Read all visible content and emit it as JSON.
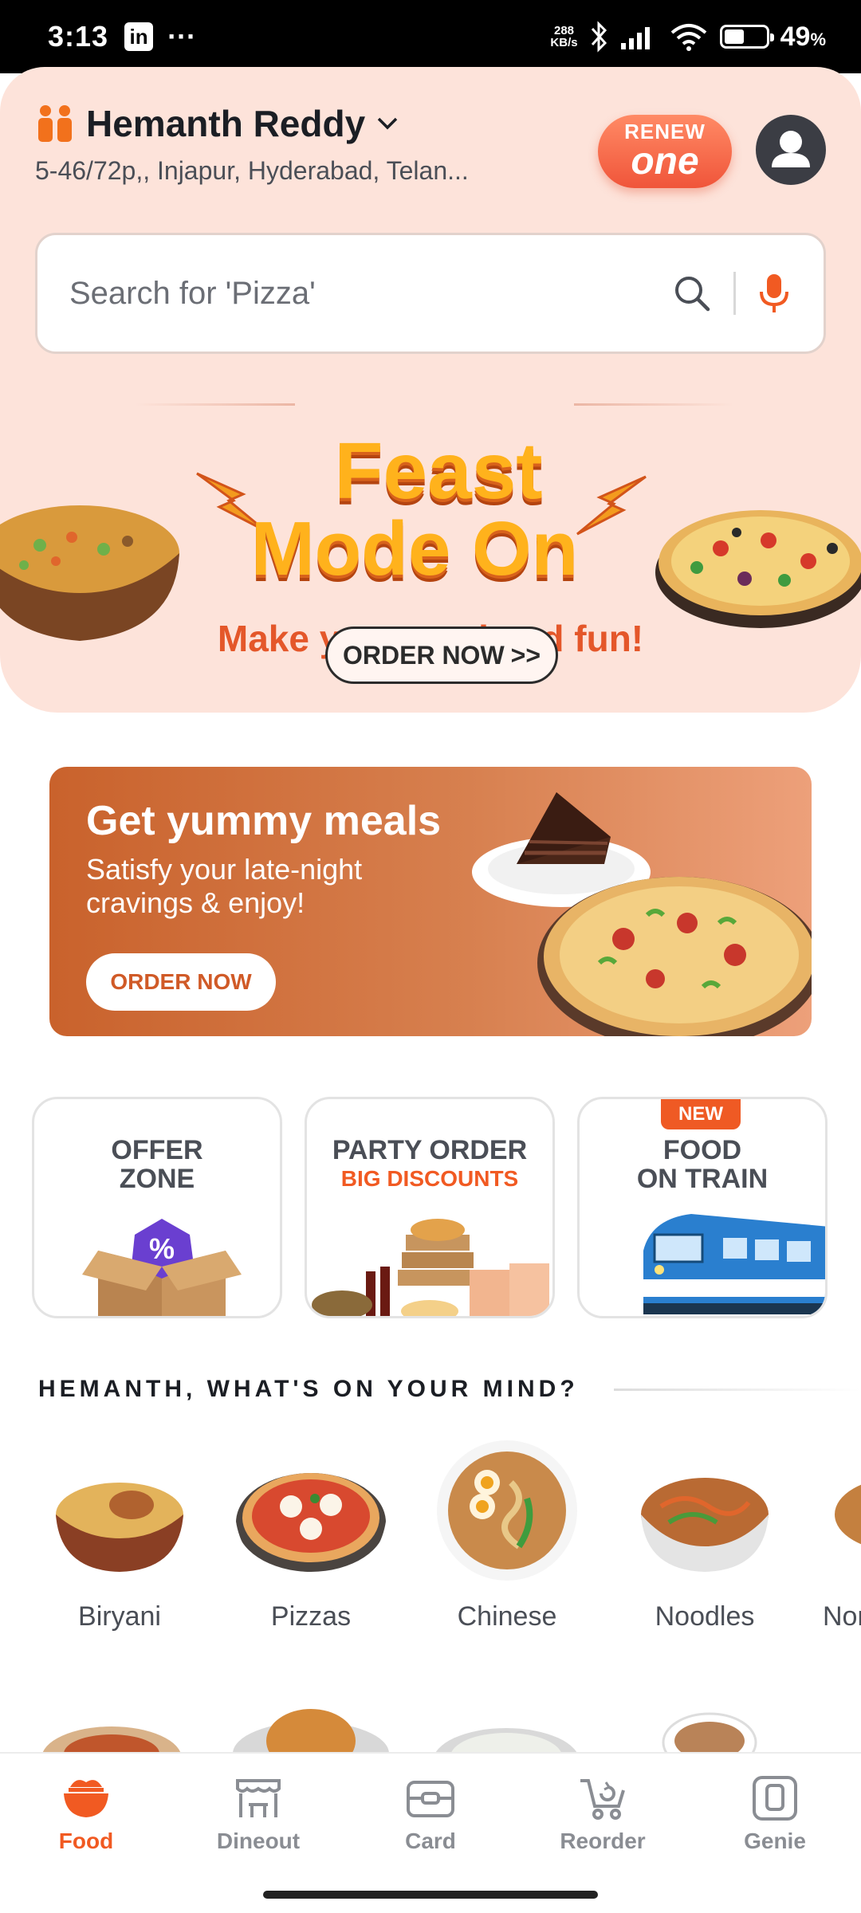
{
  "status_bar": {
    "time": "3:13",
    "app_icon": "linkedin-icon",
    "more": "···",
    "speed_value": "288",
    "speed_unit": "KB/s",
    "battery_pct": "49",
    "battery_unit": "%",
    "battery_level": 0.49
  },
  "header": {
    "user_name": "Hemanth Reddy",
    "address": "5-46/72p,, Injapur, Hyderabad, Telan...",
    "renew_top": "RENEW",
    "renew_bottom": "one"
  },
  "search": {
    "placeholder": "Search for 'Pizza'"
  },
  "feast_banner": {
    "title_line1": "Feast",
    "title_line2": "Mode On",
    "subtitle": "Make your weekend fun!",
    "button": "ORDER NOW",
    "button_arrows": ">>"
  },
  "promo_banner": {
    "title": "Get yummy meals",
    "subtitle": "Satisfy your late-night cravings & enjoy!",
    "button": "ORDER NOW"
  },
  "cards": [
    {
      "title_line1": "OFFER",
      "title_line2": "ZONE"
    },
    {
      "title_line1": "PARTY ORDER",
      "subtitle": "BIG DISCOUNTS"
    },
    {
      "badge": "NEW",
      "title_line1": "FOOD",
      "title_line2": "ON TRAIN"
    }
  ],
  "mind": {
    "title": "HEMANTH, WHAT'S ON YOUR MIND?",
    "items": [
      "Biryani",
      "Pizzas",
      "Chinese",
      "Noodles",
      "Nor"
    ]
  },
  "bottom_nav": [
    {
      "label": "Food",
      "icon": "food-bowl-icon",
      "active": true
    },
    {
      "label": "Dineout",
      "icon": "dineout-icon",
      "active": false
    },
    {
      "label": "Card",
      "icon": "card-icon",
      "active": false
    },
    {
      "label": "Reorder",
      "icon": "reorder-icon",
      "active": false
    },
    {
      "label": "Genie",
      "icon": "genie-icon",
      "active": false
    }
  ],
  "colors": {
    "accent": "#f15a22",
    "hero_bg": "#fde3da"
  }
}
